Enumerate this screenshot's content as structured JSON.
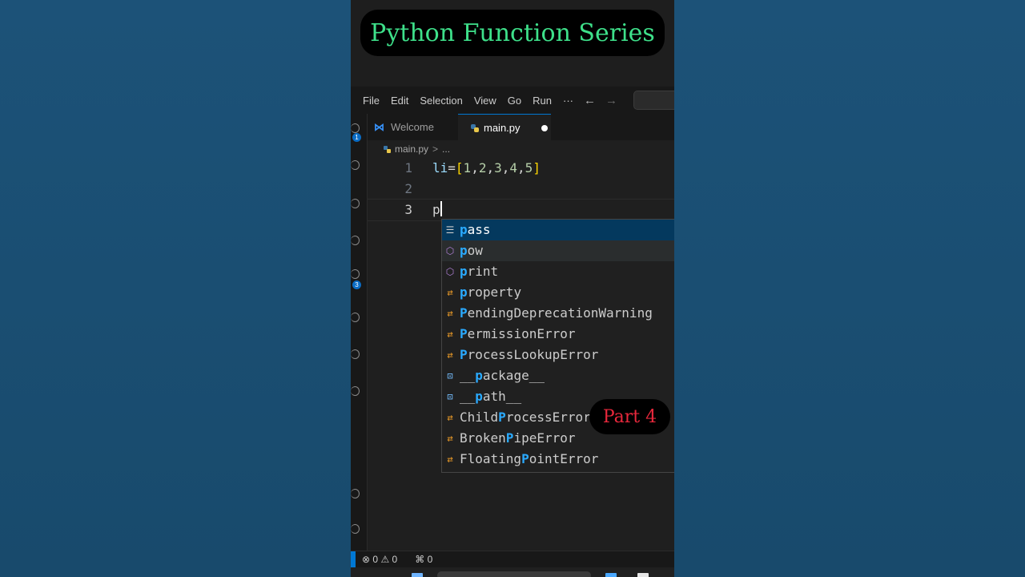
{
  "overlay": {
    "title": "Python Function Series",
    "part_label": "Part 4",
    "title_color": "#3ee08a",
    "part_color": "#e8283c"
  },
  "menubar": {
    "items": [
      "File",
      "Edit",
      "Selection",
      "View",
      "Go",
      "Run"
    ],
    "more": "···",
    "back_arrow": "←",
    "forward_arrow": "→"
  },
  "activity_bar": {
    "badges": [
      "1",
      "3"
    ]
  },
  "tabs": [
    {
      "label": "Welcome",
      "icon": "vscode-icon",
      "active": false
    },
    {
      "label": "main.py",
      "icon": "python-file-icon",
      "active": true,
      "dirty": true
    }
  ],
  "breadcrumb": {
    "file": "main.py",
    "separator": ">",
    "rest": "..."
  },
  "editor": {
    "lines": [
      {
        "number": "1",
        "var": "li",
        "op": "=",
        "open": "[",
        "items": [
          "1",
          "2",
          "3",
          "4",
          "5"
        ],
        "close": "]"
      },
      {
        "number": "2",
        "text": ""
      },
      {
        "number": "3",
        "text": "p"
      }
    ]
  },
  "suggestions": [
    {
      "kind": "keyword",
      "icon": "keyword-icon",
      "pre": "",
      "match": "p",
      "post": "ass",
      "selected": true
    },
    {
      "kind": "function",
      "icon": "function-icon",
      "pre": "",
      "match": "p",
      "post": "ow",
      "hover": true
    },
    {
      "kind": "function",
      "icon": "function-icon",
      "pre": "",
      "match": "p",
      "post": "rint"
    },
    {
      "kind": "class",
      "icon": "class-icon",
      "pre": "",
      "match": "p",
      "post": "roperty"
    },
    {
      "kind": "class",
      "icon": "class-icon",
      "pre": "",
      "match": "P",
      "post": "endingDeprecationWarning"
    },
    {
      "kind": "class",
      "icon": "class-icon",
      "pre": "",
      "match": "P",
      "post": "ermissionError"
    },
    {
      "kind": "class",
      "icon": "class-icon",
      "pre": "",
      "match": "P",
      "post": "rocessLookupError"
    },
    {
      "kind": "variable",
      "icon": "variable-icon",
      "pre": "__",
      "match": "p",
      "post": "ackage__"
    },
    {
      "kind": "variable",
      "icon": "variable-icon",
      "pre": "__",
      "match": "p",
      "post": "ath__"
    },
    {
      "kind": "class",
      "icon": "class-icon",
      "pre": "Child",
      "match": "P",
      "post": "rocessError"
    },
    {
      "kind": "class",
      "icon": "class-icon",
      "pre": "Broken",
      "match": "P",
      "post": "ipeError"
    },
    {
      "kind": "class",
      "icon": "class-icon",
      "pre": "Floating",
      "match": "P",
      "post": "ointError"
    }
  ],
  "statusbar": {
    "errors": "0",
    "warnings": "0",
    "ports": "0"
  }
}
